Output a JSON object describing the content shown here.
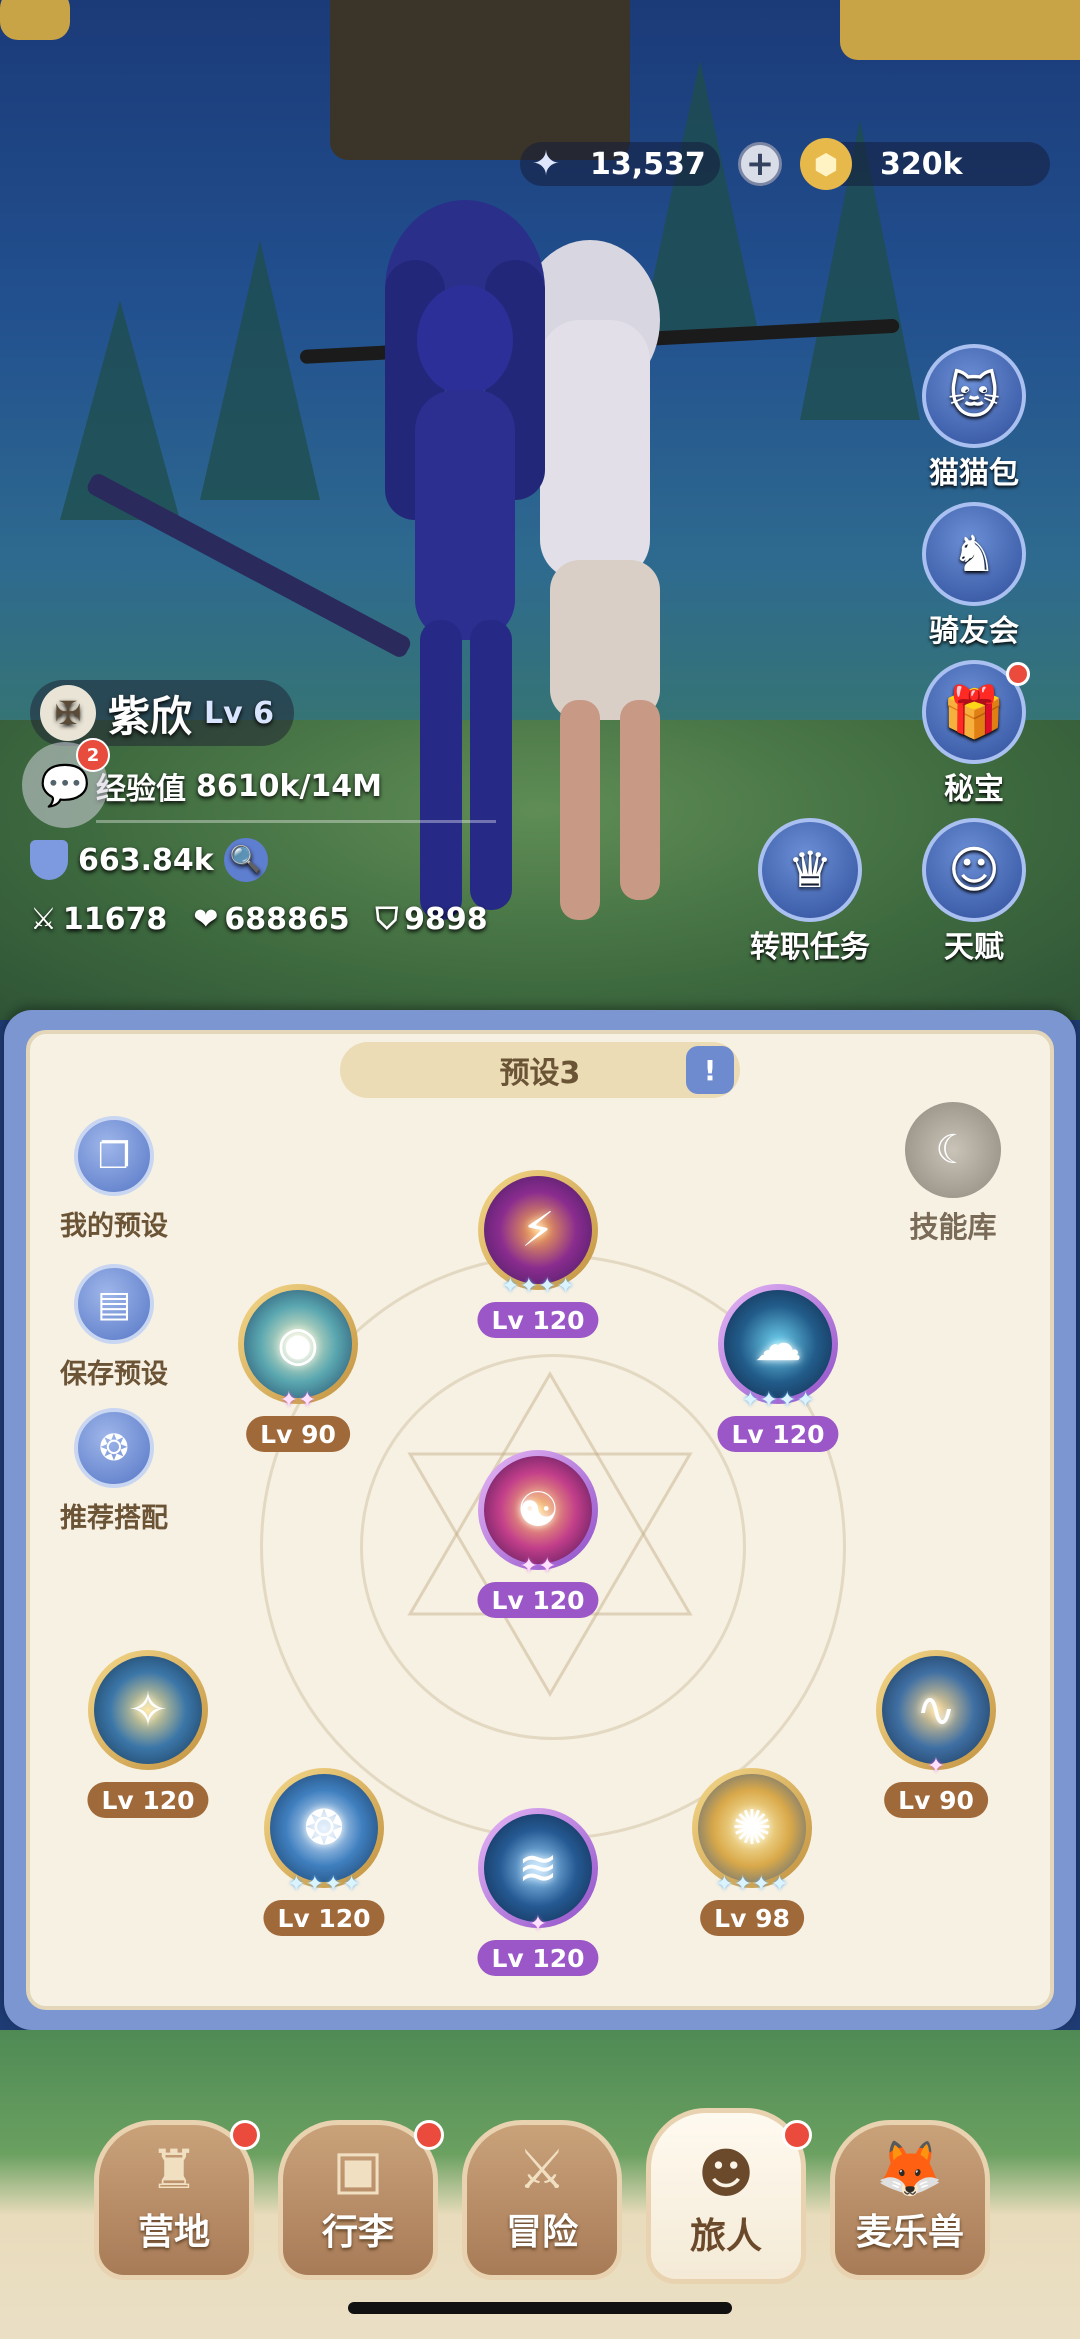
{
  "currency": {
    "stars": "13,537",
    "gold": "320k",
    "star_icon": "crystal-star-icon",
    "gold_icon": "gold-coin-icon",
    "plus_label": "+"
  },
  "side_buttons": [
    {
      "label": "猫猫包",
      "icon": "cat-bag-icon",
      "badge": false
    },
    {
      "label": "骑友会",
      "icon": "horse-icon",
      "badge": false
    },
    {
      "label": "秘宝",
      "icon": "treasure-chest-icon",
      "badge": true
    },
    {
      "label": "天赋",
      "icon": "talent-head-icon",
      "badge": false
    },
    {
      "label": "转职任务",
      "icon": "crown-job-icon",
      "badge": false
    }
  ],
  "player": {
    "name": "紫欣",
    "level": "Lv 6",
    "exp_label": "经验值",
    "exp_value": "8610k/14M",
    "power": "663.84k",
    "attack": "11678",
    "hp": "688865",
    "defense": "9898",
    "chat_badge": "2"
  },
  "panel": {
    "preset_title": "预设3",
    "left_buttons": [
      "我的预设",
      "保存预设",
      "推荐搭配"
    ],
    "skill_library": "技能库"
  },
  "skills": [
    {
      "id": "top",
      "level": "Lv 120",
      "stars": "✦✦✦✦",
      "style": "purple"
    },
    {
      "id": "left-top",
      "level": "Lv 90",
      "stars": "✦✦",
      "style": "brown"
    },
    {
      "id": "right-top",
      "level": "Lv 120",
      "stars": "✦✦✦✦",
      "style": "purple"
    },
    {
      "id": "center",
      "level": "Lv 120",
      "stars": "✦✦",
      "style": "purple"
    },
    {
      "id": "bottom-left-1",
      "level": "Lv 120",
      "stars": "",
      "style": "brown"
    },
    {
      "id": "bottom-left-2",
      "level": "Lv 120",
      "stars": "✦✦✦✦",
      "style": "brown"
    },
    {
      "id": "bottom-center",
      "level": "Lv 120",
      "stars": "✦",
      "style": "purple"
    },
    {
      "id": "bottom-right-2",
      "level": "Lv 98",
      "stars": "✦✦✦✦",
      "style": "brown"
    },
    {
      "id": "bottom-right-1",
      "level": "Lv 90",
      "stars": "✦",
      "style": "brown"
    }
  ],
  "nav": [
    {
      "label": "营地",
      "icon": "castle-icon",
      "badge": true,
      "active": false
    },
    {
      "label": "行李",
      "icon": "backpack-icon",
      "badge": true,
      "active": false
    },
    {
      "label": "冒险",
      "icon": "crossed-swords-icon",
      "badge": false,
      "active": false
    },
    {
      "label": "旅人",
      "icon": "traveler-avatar-icon",
      "badge": true,
      "active": true
    },
    {
      "label": "麦乐兽",
      "icon": "fox-pet-icon",
      "badge": false,
      "active": false
    }
  ]
}
